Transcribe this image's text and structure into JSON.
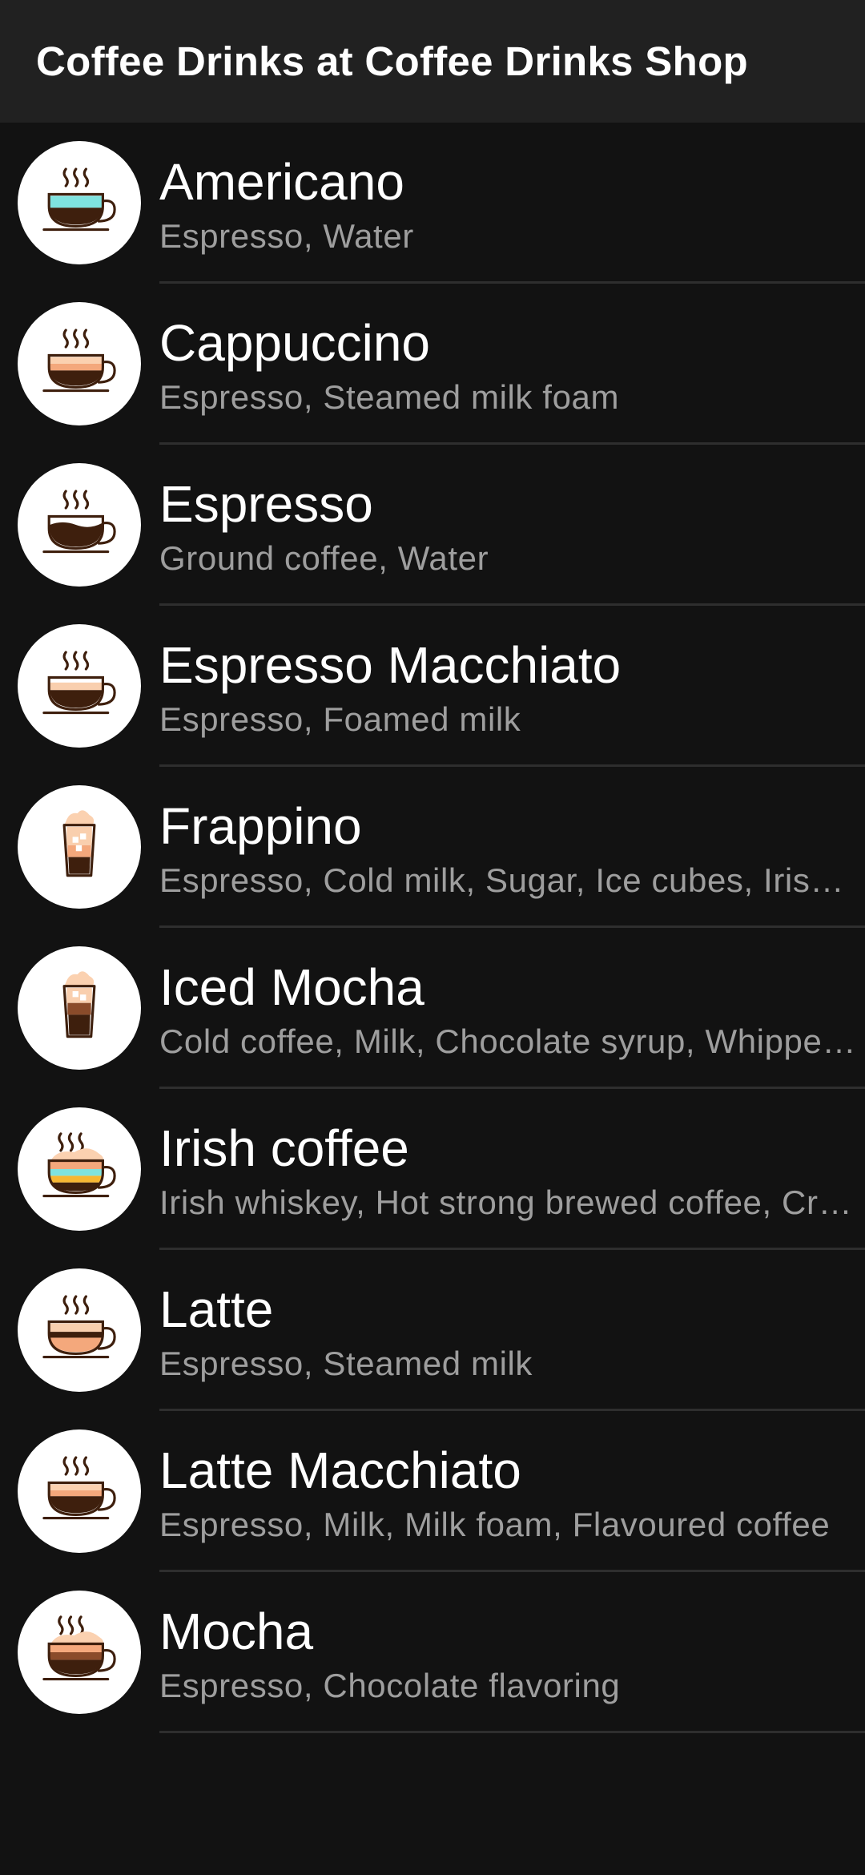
{
  "app_bar": {
    "title": "Coffee Drinks at Coffee Drinks Shop"
  },
  "drinks": [
    {
      "name": "Americano",
      "ingredients": "Espresso, Water",
      "icon": "americano-cup-icon"
    },
    {
      "name": "Cappuccino",
      "ingredients": "Espresso, Steamed milk foam",
      "icon": "cappuccino-cup-icon"
    },
    {
      "name": "Espresso",
      "ingredients": "Ground coffee, Water",
      "icon": "espresso-cup-icon"
    },
    {
      "name": "Espresso Macchiato",
      "ingredients": "Espresso, Foamed milk",
      "icon": "macchiato-cup-icon"
    },
    {
      "name": "Frappino",
      "ingredients": "Espresso, Cold milk, Sugar, Ice cubes, Irish cream, Whipped cream",
      "icon": "frappino-glass-icon"
    },
    {
      "name": "Iced Mocha",
      "ingredients": "Cold coffee, Milk, Chocolate syrup, Whipped cream",
      "icon": "iced-mocha-glass-icon"
    },
    {
      "name": "Irish coffee",
      "ingredients": "Irish whiskey, Hot strong brewed coffee, Cream",
      "icon": "irish-coffee-cup-icon"
    },
    {
      "name": "Latte",
      "ingredients": "Espresso, Steamed milk",
      "icon": "latte-cup-icon"
    },
    {
      "name": "Latte Macchiato",
      "ingredients": "Espresso, Milk, Milk foam, Flavoured coffee",
      "icon": "latte-macchiato-cup-icon"
    },
    {
      "name": "Mocha",
      "ingredients": "Espresso, Chocolate flavoring",
      "icon": "mocha-cup-icon"
    }
  ],
  "colors": {
    "background": "#121212",
    "app_bar": "#212121",
    "title_text": "#ffffff",
    "subtitle_text": "#9e9e9e",
    "divider": "#2e2e2e",
    "coffee": "#3e1f0d",
    "cup_outline": "#3e1f0d"
  }
}
